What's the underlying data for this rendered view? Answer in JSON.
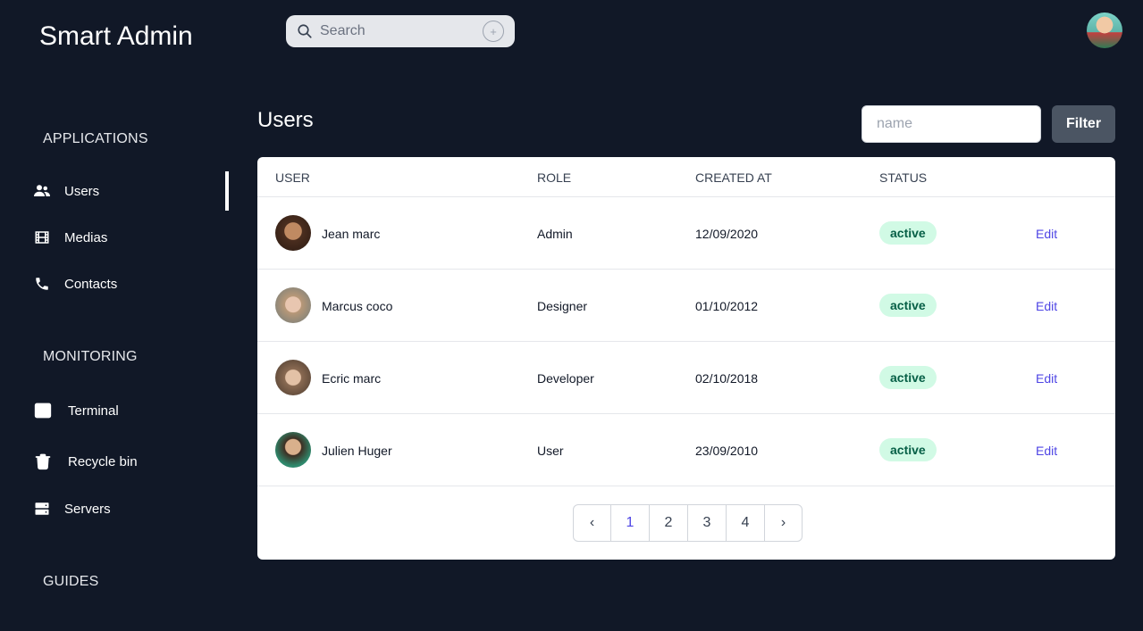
{
  "app": {
    "title": "Smart Admin"
  },
  "search": {
    "placeholder": "Search",
    "plus": "+"
  },
  "sidebar": {
    "sections": [
      {
        "title": "APPLICATIONS"
      },
      {
        "title": "MONITORING"
      },
      {
        "title": "GUIDES"
      }
    ],
    "items": [
      {
        "label": "Users",
        "icon": "users-icon",
        "active": true
      },
      {
        "label": "Medias",
        "icon": "film-icon"
      },
      {
        "label": "Contacts",
        "icon": "phone-icon"
      },
      {
        "label": "Terminal",
        "icon": "terminal-icon"
      },
      {
        "label": "Recycle bin",
        "icon": "trash-icon"
      },
      {
        "label": "Servers",
        "icon": "server-icon"
      }
    ]
  },
  "main": {
    "title": "Users",
    "filter_placeholder": "name",
    "filter_button": "Filter",
    "table": {
      "headers": [
        "USER",
        "ROLE",
        "CREATED AT",
        "STATUS"
      ],
      "rows": [
        {
          "name": "Jean marc",
          "role": "Admin",
          "created": "12/09/2020",
          "status": "active",
          "action": "Edit"
        },
        {
          "name": "Marcus coco",
          "role": "Designer",
          "created": "01/10/2012",
          "status": "active",
          "action": "Edit"
        },
        {
          "name": "Ecric marc",
          "role": "Developer",
          "created": "02/10/2018",
          "status": "active",
          "action": "Edit"
        },
        {
          "name": "Julien Huger",
          "role": "User",
          "created": "23/09/2010",
          "status": "active",
          "action": "Edit"
        }
      ]
    },
    "pagination": {
      "prev": "‹",
      "pages": [
        "1",
        "2",
        "3",
        "4"
      ],
      "current": "1",
      "next": "›"
    }
  },
  "colors": {
    "background": "#111827",
    "accent": "#4f46e5",
    "badge_bg": "#d1fae5",
    "badge_text": "#065f46"
  }
}
